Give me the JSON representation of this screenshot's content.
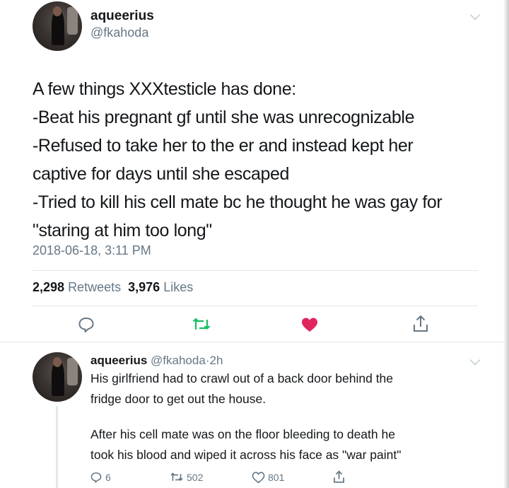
{
  "tweet": {
    "display_name": "aqueerius",
    "handle": "@fkahoda",
    "text_lines": [
      "A few things XXXtesticle has done:",
      "-Beat his pregnant gf until she was unrecognizable",
      "-Refused to take her to the er and instead kept her",
      "captive for days until she escaped",
      "-Tried to kill his cell mate bc he thought he was gay for",
      "\"staring at him too long\""
    ],
    "timestamp": "2018-06-18, 3:11 PM",
    "retweets_count": "2,298",
    "retweets_label": "Retweets",
    "likes_count": "3,976",
    "likes_label": "Likes"
  },
  "reply": {
    "display_name": "aqueerius",
    "handle": "@fkahoda",
    "separator": "·",
    "time_ago": "2h",
    "paragraph1_lines": [
      "His girlfriend had to crawl out of a back door behind the",
      "fridge door to get out the house."
    ],
    "paragraph2_lines": [
      "After his cell mate was on the floor bleeding to death he",
      "took his blood and wiped it across his face as \"war paint\""
    ],
    "reply_count": "6",
    "retweet_count": "502",
    "like_count": "801"
  },
  "icons": {
    "reply": "reply-icon",
    "retweet": "retweet-icon",
    "like": "heart-icon",
    "share": "share-icon",
    "menu": "chevron-down-icon"
  },
  "colors": {
    "like_active": "#e0245e",
    "retweet": "#17bf63",
    "secondary_text": "#657786",
    "divider": "#e1e8ed"
  }
}
